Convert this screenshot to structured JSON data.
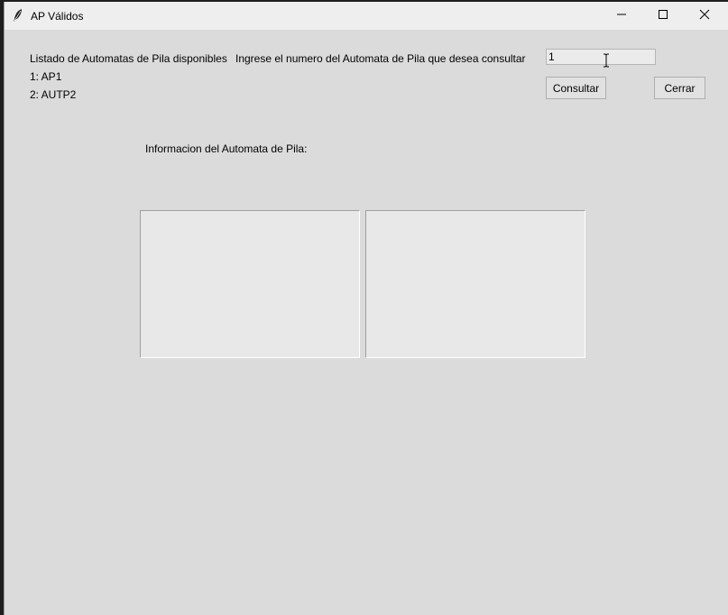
{
  "window": {
    "title": "AP Válidos",
    "icons": {
      "app": "feather-icon",
      "minimize": "minimize-icon",
      "maximize": "maximize-icon",
      "close": "close-icon"
    }
  },
  "main": {
    "list_heading": "Listado de Automatas de Pila disponibles",
    "list_items": [
      "1: AP1",
      "2: AUTP2"
    ],
    "prompt": "Ingrese el numero del Automata de Pila que desea consultar",
    "entry_value": "1",
    "consultar_label": "Consultar",
    "cerrar_label": "Cerrar",
    "info_label": "Informacion del Automata de Pila:"
  }
}
